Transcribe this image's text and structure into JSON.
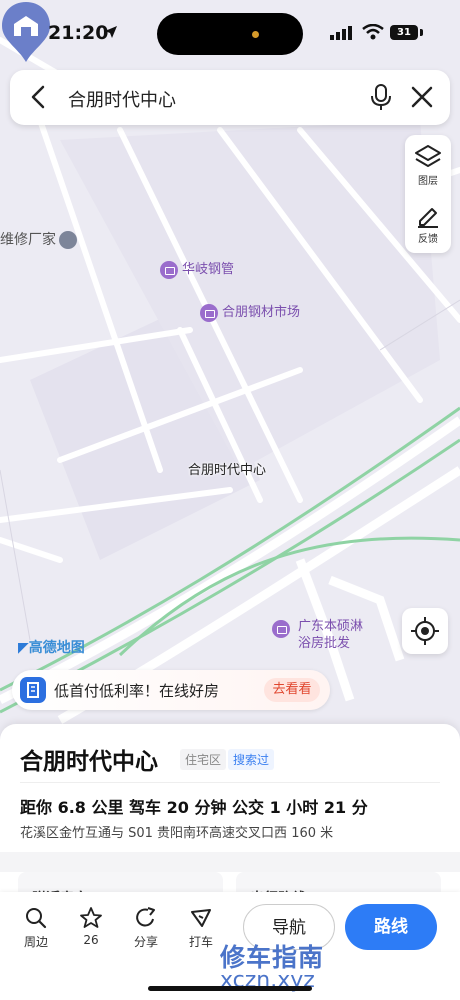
{
  "status": {
    "time": "21:20",
    "battery": "31"
  },
  "search": {
    "query": "合朋时代中心"
  },
  "tools": {
    "layers_label": "图层",
    "feedback_label": "反馈"
  },
  "map": {
    "poi_repair": "维修厂家",
    "poi_huaqi": "华岐钢管",
    "poi_hepeng_market": "合朋钢材市场",
    "pin_label": "合朋时代中心",
    "poi_guangdong_line1": "广东本硕淋",
    "poi_guangdong_line2": "浴房批发",
    "logo": "高德地图"
  },
  "ad": {
    "text": "低首付低利率！在线好房",
    "button": "去看看"
  },
  "sheet": {
    "title": "合朋时代中心",
    "tag_type": "住宅区",
    "tag_searched": "搜索过",
    "distance_line": "距你 6.8 公里   驾车 20 分钟   公交 1 小时 21 分",
    "address": "花溪区金竹互通与 S01 贵阳南环高速交叉口西 160 米",
    "card_left": "附近房产",
    "card_right": "出行路线"
  },
  "actions": {
    "nearby": "周边",
    "favorites_count": "26",
    "share": "分享",
    "taxi": "打车",
    "navigate": "导航",
    "route": "路线"
  },
  "watermark": {
    "line1": "修车指南",
    "line2": "xczn.xyz"
  },
  "colors": {
    "accent": "#2d7cf6",
    "poi": "#9a6dcc",
    "map_bg": "#ecebf3",
    "green_road": "#8fd3a4"
  }
}
